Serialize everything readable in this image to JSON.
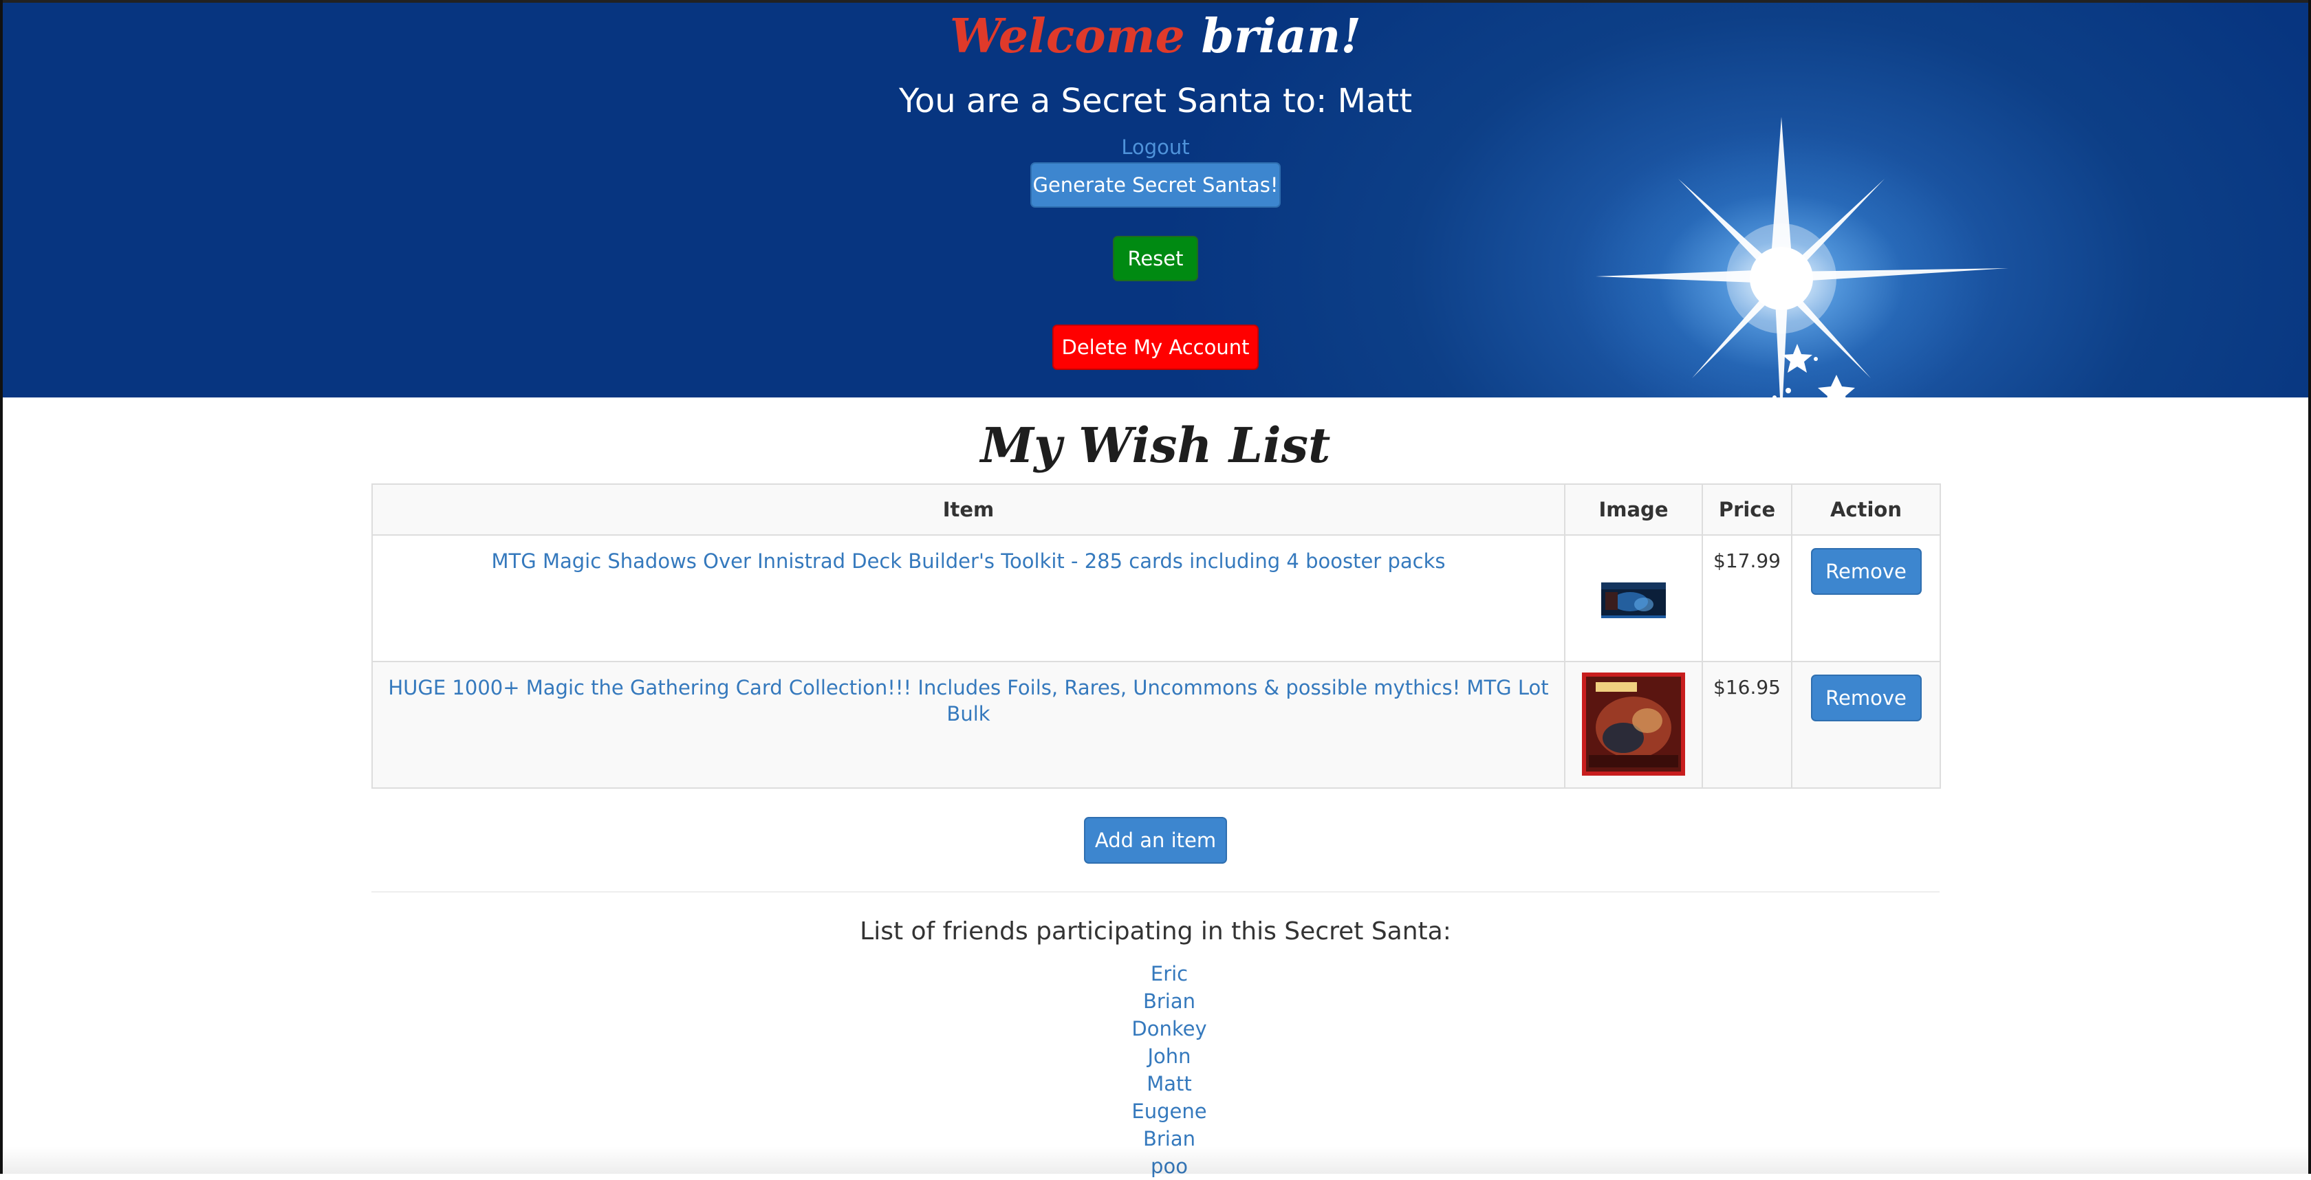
{
  "header": {
    "welcome_word": "Welcome",
    "username": "brian!",
    "secret_santa_line": "You are a Secret Santa to: Matt",
    "logout_label": "Logout",
    "generate_label": "Generate Secret Santas!",
    "reset_label": "Reset",
    "delete_label": "Delete My Account"
  },
  "wishlist": {
    "title": "My Wish List",
    "columns": [
      "Item",
      "Image",
      "Price",
      "Action"
    ],
    "items": [
      {
        "name": "MTG Magic Shadows Over Innistrad Deck Builder's Toolkit - 285 cards including 4 booster packs",
        "image": "deck-builder-box-thumbnail",
        "price": "$17.99",
        "action": "Remove"
      },
      {
        "name": "HUGE 1000+ Magic the Gathering Card Collection!!! Includes Foils, Rares, Uncommons & possible mythics! MTG Lot Bulk",
        "image": "card-collection-thumbnail",
        "price": "$16.95",
        "action": "Remove"
      }
    ],
    "add_label": "Add an item"
  },
  "friends": {
    "heading": "List of friends participating in this Secret Santa:",
    "names": [
      "Eric",
      "Brian",
      "Donkey",
      "John",
      "Matt",
      "Eugene",
      "Brian",
      "poo"
    ]
  },
  "colors": {
    "header_blue": "#073580",
    "welcome_red": "#e03a2a",
    "link_blue": "#3579bd",
    "button_blue": "#3d86cf",
    "reset_green": "#008a12",
    "delete_red": "#ff0000"
  }
}
